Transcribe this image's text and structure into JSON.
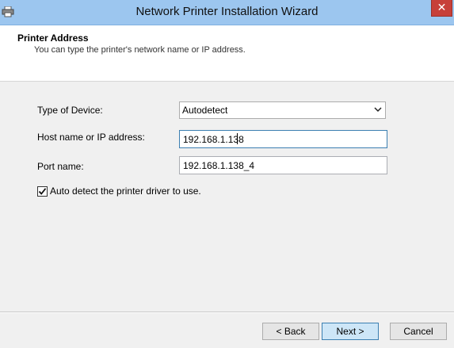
{
  "window": {
    "title": "Network Printer Installation Wizard",
    "icon": "printer-icon",
    "close_glyph": "✕"
  },
  "header": {
    "title": "Printer Address",
    "subtitle": "You can type the printer's network name or IP address."
  },
  "form": {
    "device_type": {
      "label": "Type of Device:",
      "value": "Autodetect"
    },
    "host": {
      "label": "Host name or IP address:",
      "value": "192.168.1.138"
    },
    "port": {
      "label": "Port name:",
      "value": "192.168.1.138_4"
    },
    "auto_detect": {
      "label": "Auto detect the printer driver to use.",
      "checked": true
    }
  },
  "buttons": {
    "back": "< Back",
    "next": "Next >",
    "cancel": "Cancel"
  }
}
